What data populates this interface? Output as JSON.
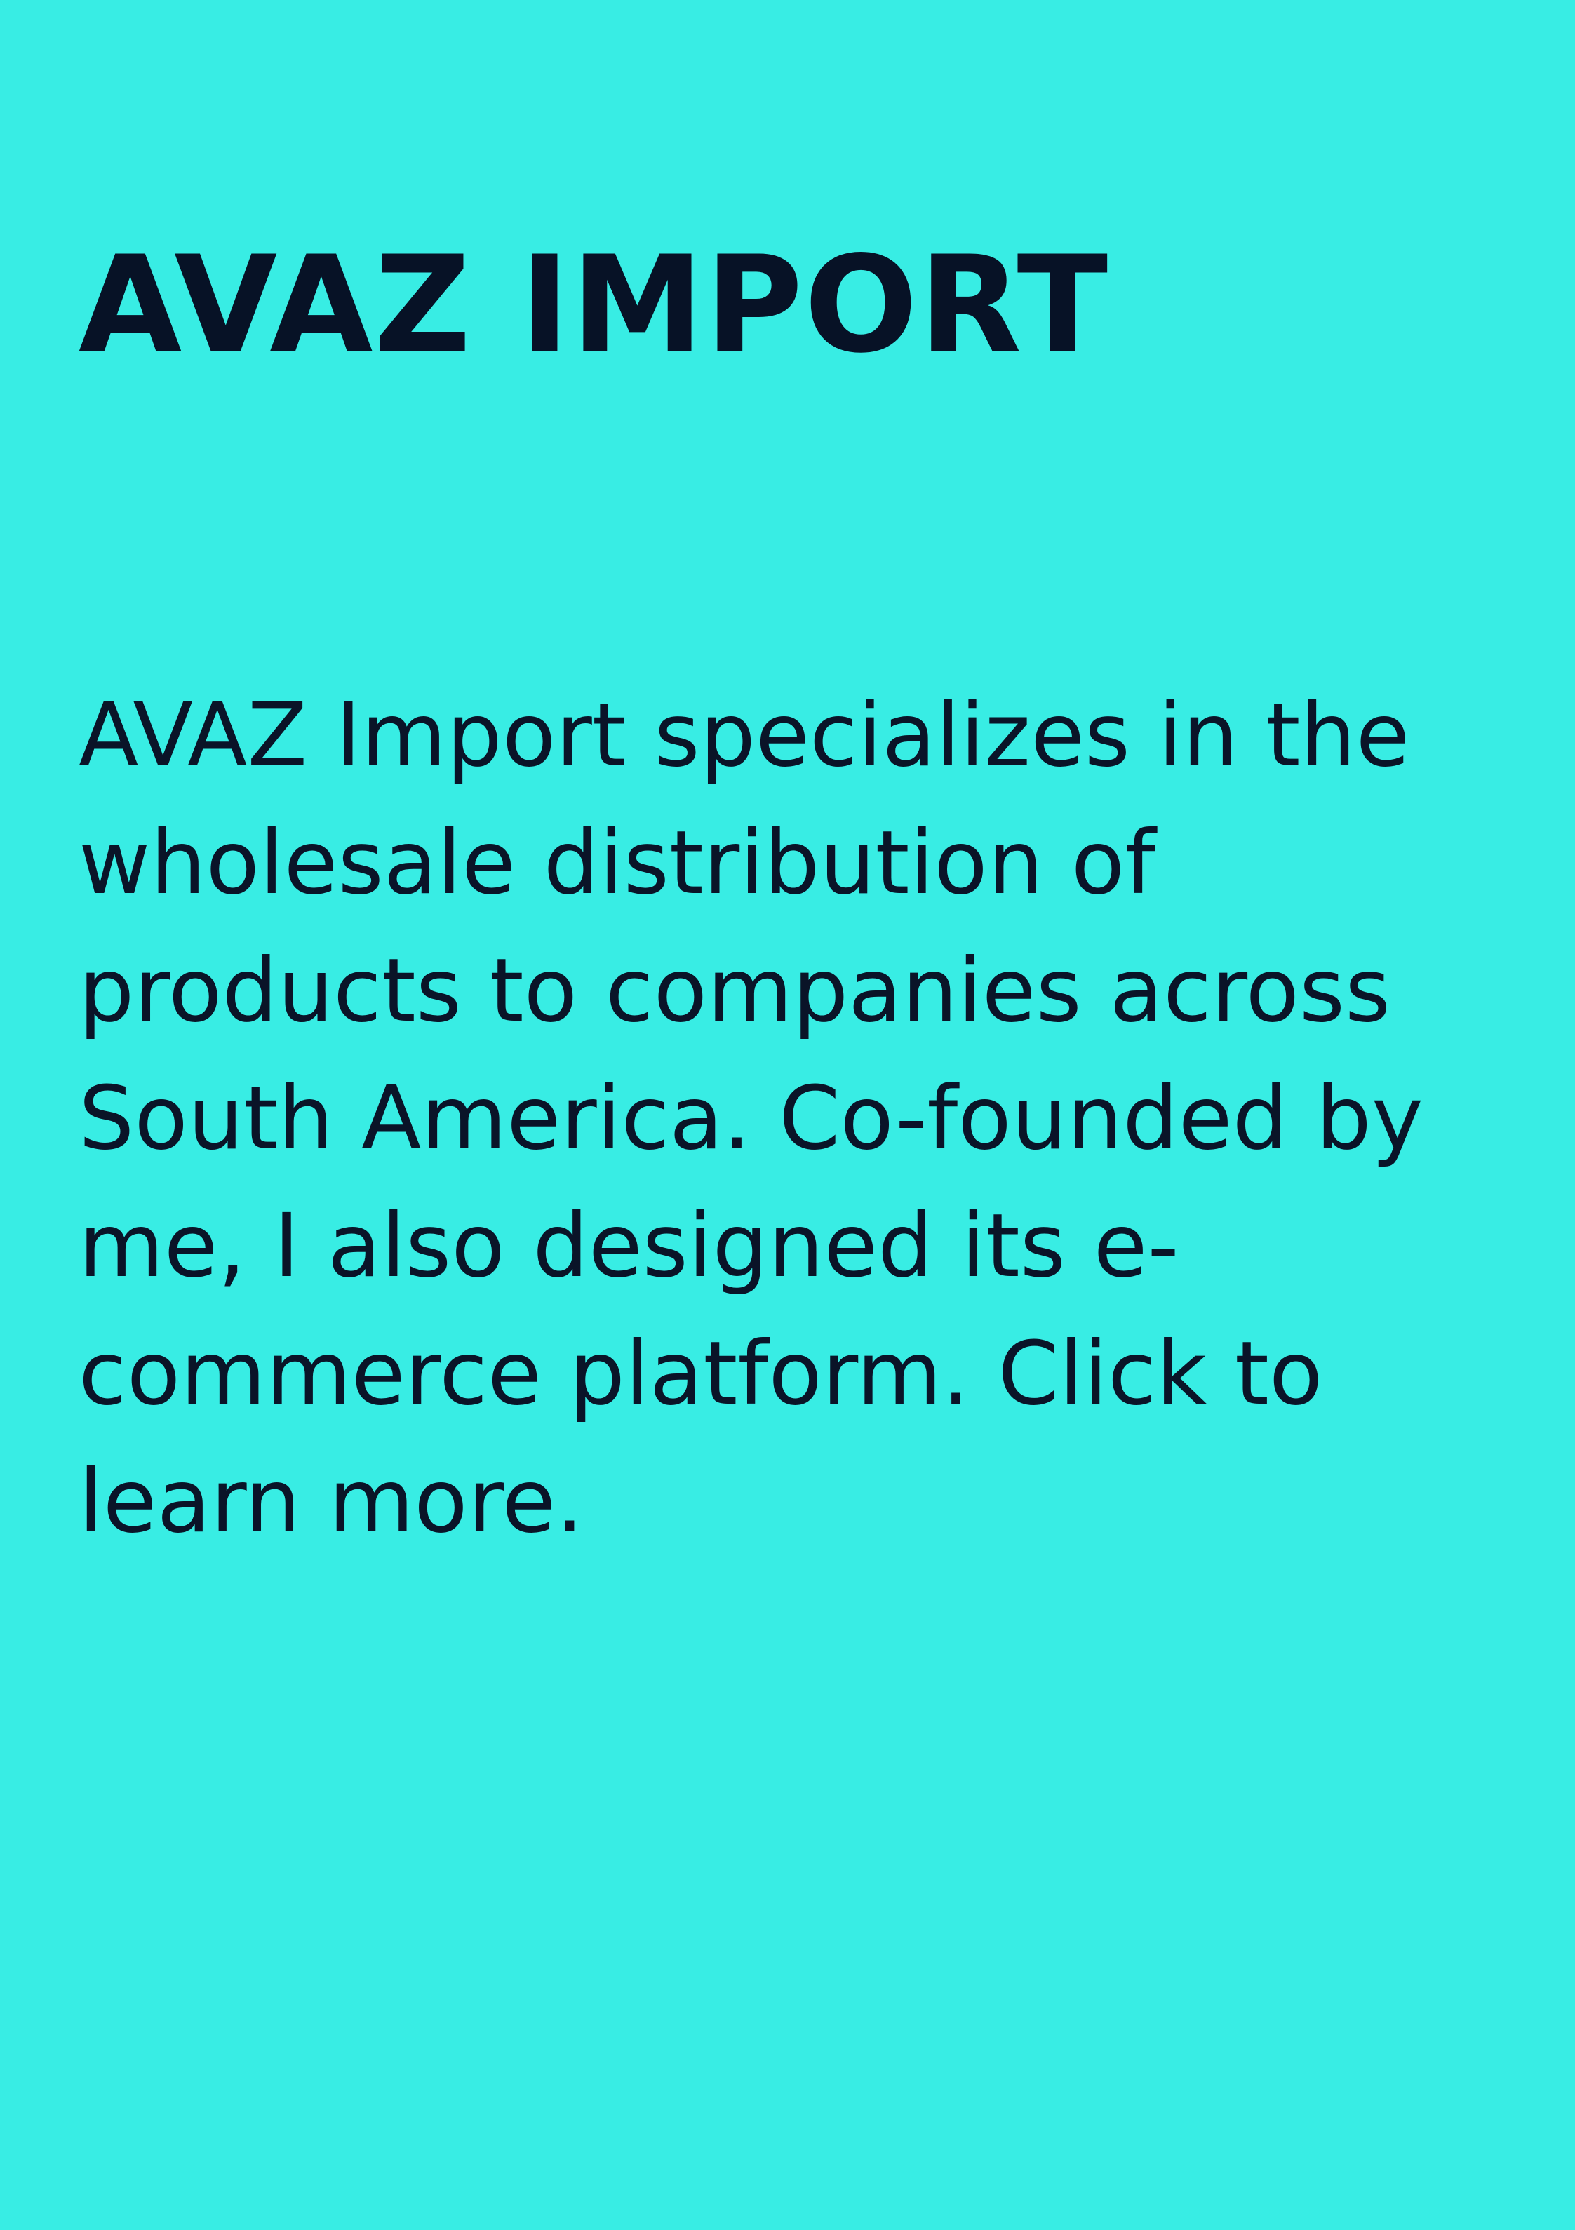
{
  "card": {
    "title": "AVAZ IMPORT",
    "description_lines": [
      "AVAZ Import specializes in the",
      "wholesale distribution of",
      "products to companies across",
      "South America. Co-founded by",
      "me, I also designed its e-",
      "commerce platform. Click to",
      "learn more."
    ]
  },
  "colors": {
    "background": "#38ede4",
    "text": "#0a1428"
  }
}
